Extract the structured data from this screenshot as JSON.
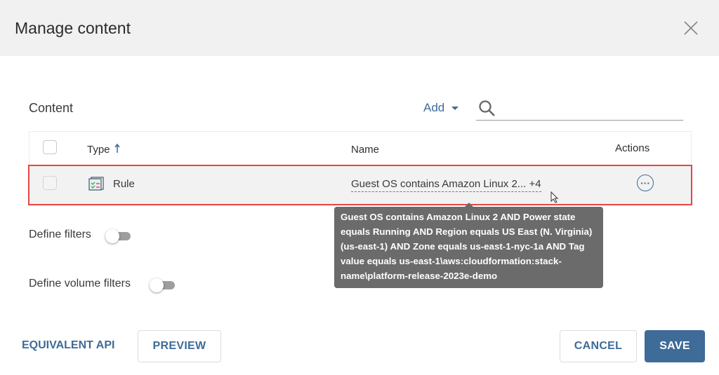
{
  "dialog": {
    "title": "Manage content",
    "close_icon": "close-icon"
  },
  "content": {
    "label": "Content",
    "add_label": "Add",
    "search_placeholder": "",
    "search_value": ""
  },
  "table": {
    "headers": {
      "type": "Type",
      "name": "Name",
      "actions": "Actions"
    },
    "sort": {
      "column": "Type",
      "direction": "ascending"
    },
    "rows": [
      {
        "type": "Rule",
        "name": "Guest OS contains Amazon Linux 2... +4",
        "checked": false
      }
    ]
  },
  "tooltip": {
    "lines": [
      "Guest OS contains Amazon Linux 2 AND Power state",
      "equals Running AND Region equals US East (N. Virginia)",
      "(us-east-1) AND Zone equals us-east-1-nyc-1a AND Tag",
      "value equals us-east-1\\aws:cloudformation:stack-",
      "name\\platform-release-2023e-demo"
    ]
  },
  "filters": {
    "define_filters": {
      "label": "Define filters",
      "on": false
    },
    "define_volume_filters": {
      "label": "Define volume filters",
      "on": false
    }
  },
  "footer": {
    "equivalent_api": "EQUIVALENT API",
    "preview": "PREVIEW",
    "cancel": "CANCEL",
    "save": "SAVE"
  },
  "colors": {
    "accent": "#3e6b98",
    "highlight_border": "#e84545",
    "tooltip_bg": "#6b6b6b"
  }
}
